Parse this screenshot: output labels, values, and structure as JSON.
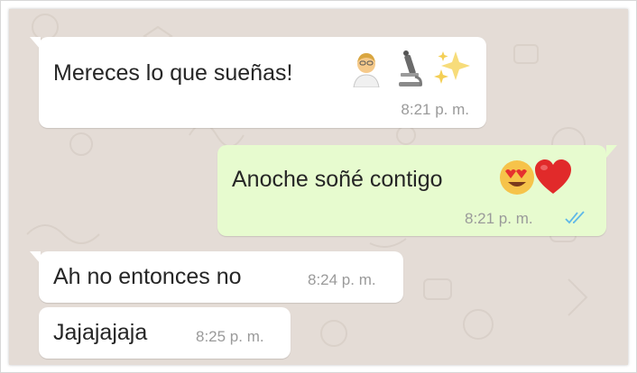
{
  "messages": [
    {
      "direction": "incoming",
      "text": "Mereces lo que sueñas!",
      "emojis": [
        "scientist-emoji",
        "microscope-emoji",
        "sparkles-emoji"
      ],
      "time": "8:21 p. m."
    },
    {
      "direction": "outgoing",
      "text": "Anoche soñé contigo",
      "emojis": [
        "heart-eyes-emoji",
        "red-heart-emoji"
      ],
      "time": "8:21 p. m.",
      "status": "read"
    },
    {
      "direction": "incoming",
      "text": "Ah no entonces no",
      "time": "8:24 p. m."
    },
    {
      "direction": "incoming",
      "text": "Jajajajaja",
      "time": "8:25 p. m."
    }
  ],
  "colors": {
    "wallpaper": "#e4dcd6",
    "incoming_bubble": "#ffffff",
    "outgoing_bubble": "#e7fbcf",
    "read_ticks": "#5fb8e8",
    "timestamp": "#9a9a9a"
  }
}
